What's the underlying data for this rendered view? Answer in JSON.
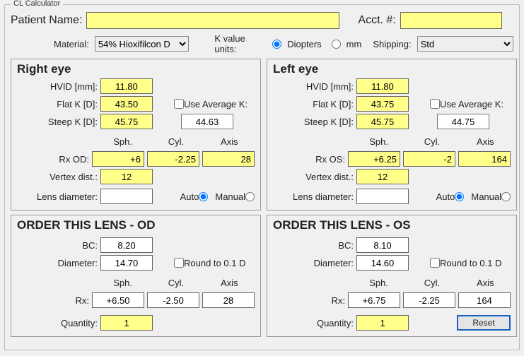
{
  "legend": "CL Calculator",
  "top": {
    "patient_label": "Patient Name:",
    "patient_value": "",
    "acct_label": "Acct. #:",
    "acct_value": ""
  },
  "settings": {
    "material_label": "Material:",
    "material_value": "54% Hioxifilcon D",
    "kunits_label": "K value units:",
    "kunits_options": {
      "diopters": "Diopters",
      "mm": "mm"
    },
    "kunits_selected": "diopters",
    "shipping_label": "Shipping:",
    "shipping_value": "Std"
  },
  "right": {
    "title": "Right eye",
    "hvid_label": "HVID [mm]:",
    "hvid": "11.80",
    "flatk_label": "Flat K [D]:",
    "flatk": "43.50",
    "steepk_label": "Steep K [D]:",
    "steepk": "45.75",
    "use_avg_label": "Use Average K:",
    "avg_k": "44.63",
    "col_sph": "Sph.",
    "col_cyl": "Cyl.",
    "col_axis": "Axis",
    "rx_label": "Rx OD:",
    "rx_sph": "+6",
    "rx_cyl": "-2.25",
    "rx_axis": "28",
    "vertex_label": "Vertex dist.:",
    "vertex": "12",
    "lensdia_label": "Lens diameter:",
    "lensdia": "",
    "auto_label": "Auto",
    "manual_label": "Manual"
  },
  "left": {
    "title": "Left eye",
    "hvid_label": "HVID [mm]:",
    "hvid": "11.80",
    "flatk_label": "Flat K [D]:",
    "flatk": "43.75",
    "steepk_label": "Steep K [D]:",
    "steepk": "45.75",
    "use_avg_label": "Use Average K:",
    "avg_k": "44.75",
    "col_sph": "Sph.",
    "col_cyl": "Cyl.",
    "col_axis": "Axis",
    "rx_label": "Rx OS:",
    "rx_sph": "+6.25",
    "rx_cyl": "-2",
    "rx_axis": "164",
    "vertex_label": "Vertex dist.:",
    "vertex": "12",
    "lensdia_label": "Lens diameter:",
    "lensdia": "",
    "auto_label": "Auto",
    "manual_label": "Manual"
  },
  "order_od": {
    "title": "ORDER THIS LENS - OD",
    "bc_label": "BC:",
    "bc": "8.20",
    "dia_label": "Diameter:",
    "dia": "14.70",
    "round_label": "Round to 0.1 D",
    "col_sph": "Sph.",
    "col_cyl": "Cyl.",
    "col_axis": "Axis",
    "rx_label": "Rx:",
    "rx_sph": "+6.50",
    "rx_cyl": "-2.50",
    "rx_axis": "28",
    "qty_label": "Quantity:",
    "qty": "1"
  },
  "order_os": {
    "title": "ORDER THIS LENS - OS",
    "bc_label": "BC:",
    "bc": "8.10",
    "dia_label": "Diameter:",
    "dia": "14.60",
    "round_label": "Round to 0.1 D",
    "col_sph": "Sph.",
    "col_cyl": "Cyl.",
    "col_axis": "Axis",
    "rx_label": "Rx:",
    "rx_sph": "+6.75",
    "rx_cyl": "-2.25",
    "rx_axis": "164",
    "qty_label": "Quantity:",
    "qty": "1",
    "reset_label": "Reset"
  }
}
